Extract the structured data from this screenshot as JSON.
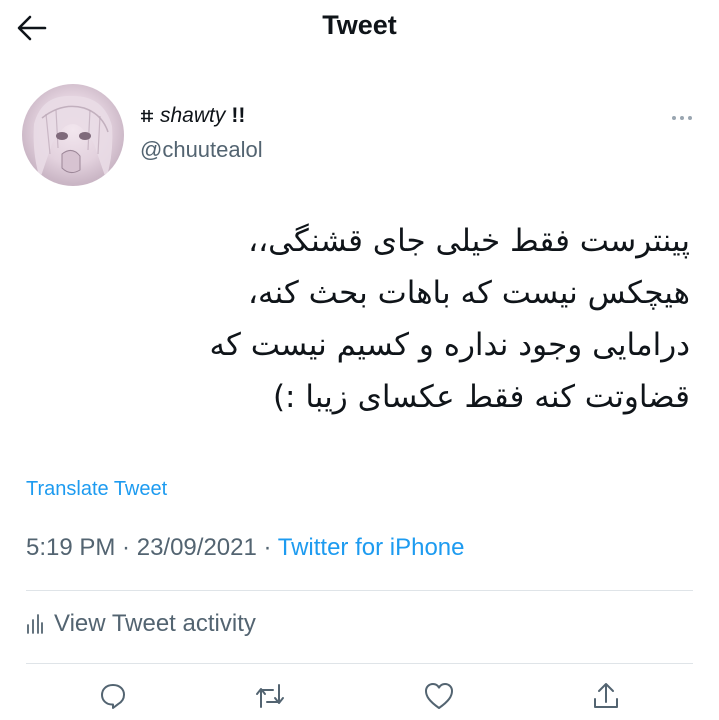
{
  "header": {
    "title": "Tweet",
    "back_icon": "arrow-left-icon"
  },
  "author": {
    "name_prefix_icon": "hash-icon",
    "display_name": "shawty",
    "display_suffix": "!!",
    "handle": "@chuutealol"
  },
  "tweet": {
    "lines": [
      "پینترست فقط خیلی جای قشنگی،،",
      "هیچکس نیست که باهات بحث کنه،",
      "درامایی وجود نداره و کسیم نیست که",
      "قضاوتت کنه فقط عکسای زیبا :)"
    ]
  },
  "translate_label": "Translate Tweet",
  "meta": {
    "time": "5:19 PM",
    "sep1": " · ",
    "date": "23/09/2021",
    "sep2": " · ",
    "source": "Twitter for iPhone"
  },
  "activity_label": "View Tweet activity",
  "actions": [
    "reply-icon",
    "retweet-icon",
    "like-icon",
    "share-icon"
  ],
  "colors": {
    "link": "#1d9bf0",
    "secondary": "#536471",
    "text": "#0f1419"
  }
}
